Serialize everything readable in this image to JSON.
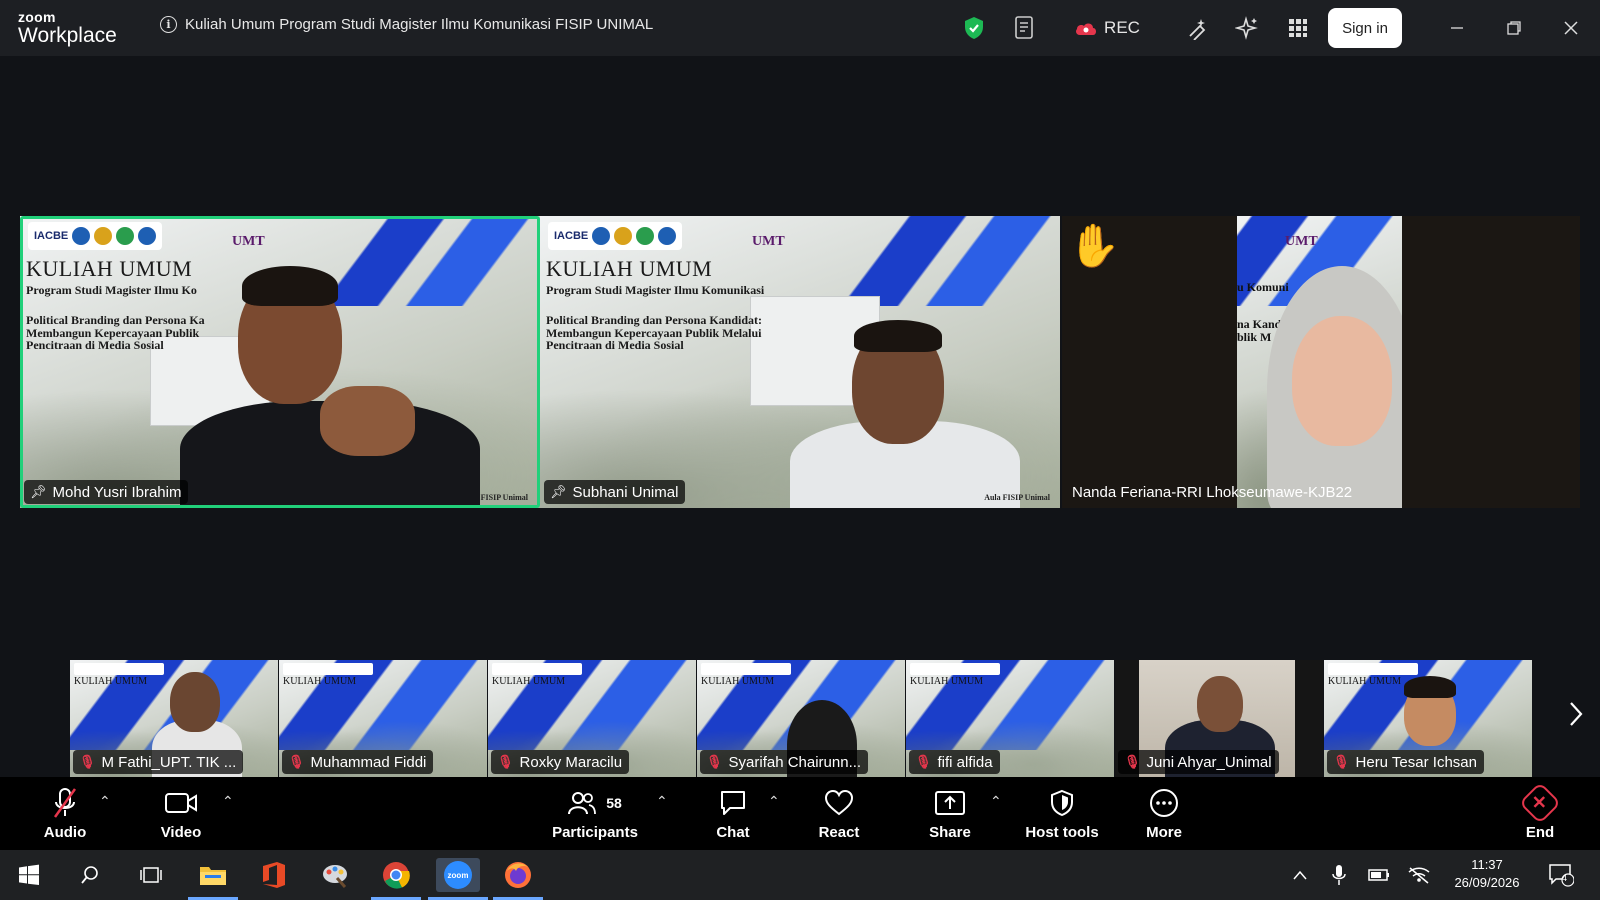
{
  "app": {
    "brand_top": "zoom",
    "brand_bottom": "Workplace"
  },
  "meeting": {
    "title": "Kuliah Umum Program Studi Magister Ilmu Komunikasi FISIP UNIMAL"
  },
  "titlebar": {
    "rec_label": "REC",
    "signin_label": "Sign in"
  },
  "slide": {
    "logos": "IACBE",
    "umt": "UMT",
    "title": "KULIAH UMUM",
    "subtitle": "Program Studi Magister Ilmu Komunikasi",
    "subtitle_cut": "Program Studi Magister Ilmu Ko",
    "topic_line1": "Political Branding dan Persona Kandidat:",
    "topic_line2": "Membangun Kepercayaan Publik Melalui",
    "topic_line3": "Pencitraan di Media Sosial",
    "topic_cut1": "Political Branding dan Persona Ka",
    "topic_cut2": "Membangun Kepercayaan Publik",
    "watermark1": "FISIP Unimal",
    "watermark2": "Aula FISIP Unimal",
    "cut_kom": "u Komuni",
    "cut_kan": "na Kand",
    "cut_blik": "blik M"
  },
  "gallery": [
    {
      "name": "Mohd Yusri Ibrahim",
      "pinned": true,
      "active": true
    },
    {
      "name": "Subhani Unimal",
      "pinned": true,
      "active": false
    },
    {
      "name": "Nanda Feriana-RRI Lhokseumawe-KJB22",
      "pinned": false,
      "hand_raised": true
    }
  ],
  "strip": [
    {
      "name": "M Fathi_UPT. TIK ...",
      "muted": true
    },
    {
      "name": "Muhammad Fiddi",
      "muted": true
    },
    {
      "name": "Roxky Maracilu",
      "muted": true
    },
    {
      "name": "Syarifah Chairunn...",
      "muted": true
    },
    {
      "name": "fifi alfida",
      "muted": true
    },
    {
      "name": "Juni Ahyar_Unimal",
      "muted": true
    },
    {
      "name": "Heru Tesar Ichsan",
      "muted": true
    }
  ],
  "toolbar": {
    "audio": "Audio",
    "video": "Video",
    "participants": "Participants",
    "participants_count": "58",
    "chat": "Chat",
    "react": "React",
    "share": "Share",
    "host_tools": "Host tools",
    "more": "More",
    "end": "End"
  },
  "taskbar": {
    "time": "11:37",
    "date": "26/09/2026",
    "notification_count": "4"
  },
  "colors": {
    "active_speaker": "#21d07a",
    "muted_red": "#e5364c",
    "shield_green": "#1db954",
    "rec_red": "#e5364c"
  }
}
